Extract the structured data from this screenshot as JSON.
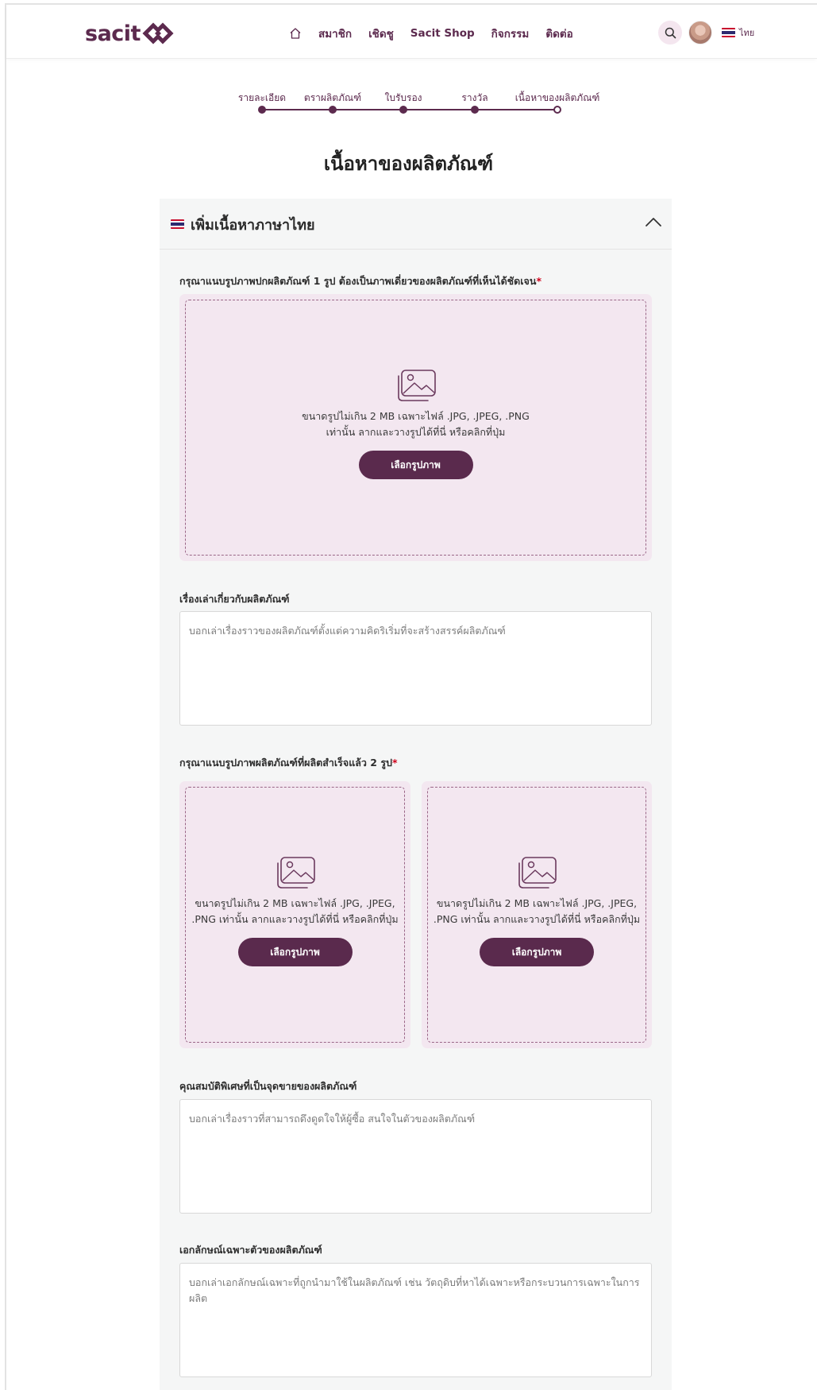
{
  "header": {
    "logo_text": "sacit",
    "nav": [
      "สมาชิก",
      "เชิดชู",
      "Sacit Shop",
      "กิจกรรม",
      "ติดต่อ"
    ],
    "language": "ไทย"
  },
  "stepper": {
    "steps": [
      "รายละเอียด",
      "ตราผลิตภัณฑ์",
      "ใบรับรอง",
      "รางวัล",
      "เนื้อหาของผลิตภัณฑ์"
    ],
    "current_index": 4
  },
  "page_title": "เนื้อหาของผลิตภัณฑ์",
  "section": {
    "title": "เพิ่มเนื้อหาภาษาไทย",
    "cover_label": "กรุณาแนบรูปภาพปกผลิตภัณฑ์ 1 รูป ต้องเป็นภาพเดี่ยวของผลิตภัณฑ์ที่เห็นได้ชัดเจน",
    "required_mark": "*",
    "cover_upload": {
      "hint_line1": "ขนาดรูปไม่เกิน 2 MB เฉพาะไฟล์ .JPG, .JPEG, .PNG",
      "hint_line2": "เท่านั้น ลากและวางรูปได้ที่นี่ หรือคลิกที่ปุ่ม",
      "button": "เลือกรูปภาพ"
    },
    "story_label": "เรื่องเล่าเกี่ยวกับผลิตภัณฑ์",
    "story_placeholder": "บอกเล่าเรื่องราวของผลิตภัณฑ์ตั้งแต่ความคิดริเริ่มที่จะสร้างสรรค์ผลิตภัณฑ์",
    "finished_label": "กรุณาแนบรูปภาพผลิตภัณฑ์ที่ผลิตสำเร็จแล้ว 2 รูป",
    "finished_uploads": [
      {
        "hint_line1": "ขนาดรูปไม่เกิน 2 MB เฉพาะไฟล์ .JPG, .JPEG,",
        "hint_line2": ".PNG เท่านั้น ลากและวางรูปได้ที่นี่ หรือคลิกที่ปุ่ม",
        "button": "เลือกรูปภาพ"
      },
      {
        "hint_line1": "ขนาดรูปไม่เกิน 2 MB เฉพาะไฟล์ .JPG, .JPEG,",
        "hint_line2": ".PNG เท่านั้น ลากและวางรูปได้ที่นี่ หรือคลิกที่ปุ่ม",
        "button": "เลือกรูปภาพ"
      }
    ],
    "selling_label": "คุณสมบัติพิเศษที่เป็นจุดขายของผลิตภัณฑ์",
    "selling_placeholder": "บอกเล่าเรื่องราวที่สามารถดึงดูดใจให้ผู้ซื้อ สนใจในตัวของผลิตภัณฑ์",
    "unique_label": "เอกลักษณ์เฉพาะตัวของผลิตภัณฑ์",
    "unique_placeholder": "บอกเล่าเอกลักษณ์เฉพาะที่ถูกนำมาใช้ในผลิตภัณฑ์ เช่น วัตถุดิบที่หาได้เฉพาะหรือกระบวนการเฉพาะในการผลิต"
  },
  "colors": {
    "brand": "#5c2a4e",
    "button": "#5a2a4d",
    "upload_bg": "#f3e7f0",
    "panel_bg": "#f5f6f6",
    "required": "#d0021b"
  },
  "icons": [
    "home-icon",
    "search-icon",
    "thai-flag-icon",
    "chevron-up-icon",
    "image-upload-icon"
  ]
}
